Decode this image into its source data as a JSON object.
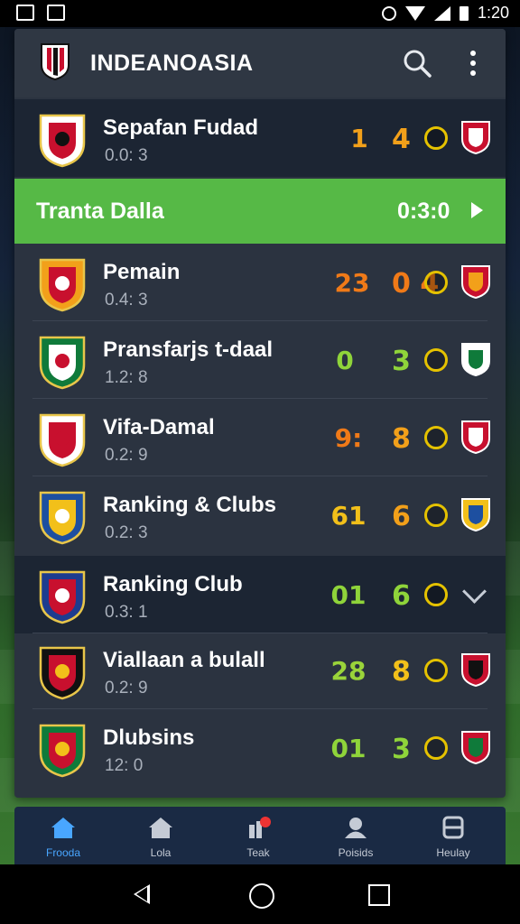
{
  "status_bar": {
    "time": "1:20"
  },
  "app": {
    "title": "INDEANOASIA"
  },
  "matches": [
    {
      "name": "Sepafan Fudad",
      "time": "0.0: 3",
      "score_a": "1",
      "score_b": "4",
      "score_a_color": "#f2a01a",
      "score_b_color": "#f2a01a",
      "dark": true
    },
    {
      "name": "Pemain",
      "time": "0.4: 3",
      "score_a": "23",
      "score_b": "0 4",
      "score_a_color": "#f07a18",
      "score_b_color": "#f07a18",
      "dark": false
    },
    {
      "name": "Pransfarjs t-daal",
      "time": "1.2: 8",
      "score_a": "0",
      "score_b": "3",
      "score_a_color": "#8fd43a",
      "score_b_color": "#8fd43a",
      "dark": false
    },
    {
      "name": "Vifa-Damal",
      "time": "0.2: 9",
      "score_a": "9:",
      "score_b": "8",
      "score_a_color": "#f07a18",
      "score_b_color": "#f2a01a",
      "dark": false
    },
    {
      "name": "Ranking & Clubs",
      "time": "0.2: 3",
      "score_a": "61",
      "score_b": "6",
      "score_a_color": "#f2c01a",
      "score_b_color": "#f2a01a",
      "dark": false
    },
    {
      "name": "Ranking Club",
      "time": "0.3: 1",
      "score_a": "01",
      "score_b": "6",
      "score_a_color": "#8fd43a",
      "score_b_color": "#8fd43a",
      "dark": true
    },
    {
      "name": "Viallaan a bulall",
      "time": "0.2: 9",
      "score_a": "28",
      "score_b": "8",
      "score_a_color": "#9ad43a",
      "score_b_color": "#f2c01a",
      "dark": false
    },
    {
      "name": "Dlubsins",
      "time": "12: 0",
      "score_a": "01",
      "score_b": "3",
      "score_a_color": "#8fd43a",
      "score_b_color": "#8fd43a",
      "dark": false
    }
  ],
  "banner": {
    "title": "Tranta Dalla",
    "time": "0:3:0",
    "color": "#56b946"
  },
  "bottom_nav": [
    {
      "label": "Frooda",
      "icon": "home-icon",
      "active": true
    },
    {
      "label": "Lola",
      "icon": "house-icon",
      "active": false
    },
    {
      "label": "Teak",
      "icon": "notification-icon",
      "active": false
    },
    {
      "label": "Poisids",
      "icon": "profile-icon",
      "active": false
    },
    {
      "label": "Heulay",
      "icon": "settings-icon",
      "active": false
    }
  ]
}
